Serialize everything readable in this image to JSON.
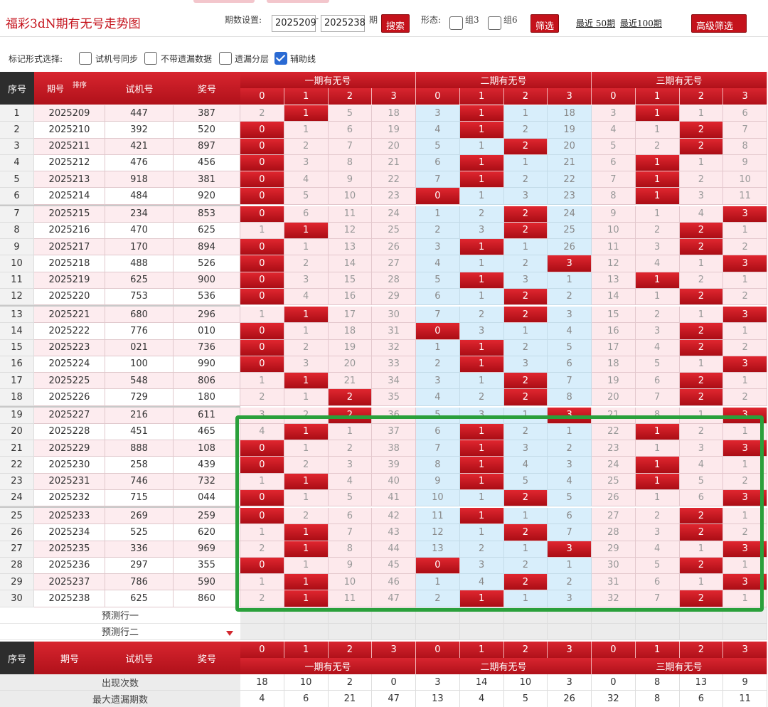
{
  "header": {
    "title": "福彩3dN期有无号走势图",
    "period_label": "期数设置:",
    "period_from": "2025209",
    "period_to": "2025238",
    "dash": "-",
    "period_suffix": "期",
    "search_label": "搜索",
    "shape_label": "形态:",
    "group3_label": "组3",
    "group6_label": "组6",
    "filter_label": "筛选",
    "recent50_label": "最近 50期",
    "recent100_label": "最近100期",
    "advanced_filter_label": "高级筛选"
  },
  "mark_options": {
    "label": "标记形式选择:",
    "items": [
      {
        "label": "试机号同步",
        "checked": false
      },
      {
        "label": "不带遗漏数据",
        "checked": false
      },
      {
        "label": "遗漏分层",
        "checked": false
      },
      {
        "label": "辅助线",
        "checked": true
      }
    ]
  },
  "table": {
    "col_index": "序号",
    "col_period": "期号",
    "sort_label": "排序",
    "col_trial": "试机号",
    "col_draw": "奖号",
    "group_titles": [
      "一期有无号",
      "二期有无号",
      "三期有无号"
    ],
    "sub_cols": [
      "0",
      "1",
      "2",
      "3"
    ],
    "rows": [
      {
        "i": "1",
        "p": "2025209",
        "t": "447",
        "d": "387",
        "v": [
          2,
          1,
          5,
          18,
          3,
          1,
          1,
          18,
          3,
          1,
          1,
          6
        ],
        "h": [
          0,
          1,
          0,
          0,
          0,
          1,
          0,
          0,
          0,
          1,
          0,
          0
        ]
      },
      {
        "i": "2",
        "p": "2025210",
        "t": "392",
        "d": "520",
        "v": [
          0,
          1,
          6,
          19,
          4,
          1,
          2,
          19,
          4,
          1,
          2,
          7
        ],
        "h": [
          1,
          0,
          0,
          0,
          0,
          1,
          0,
          0,
          0,
          0,
          1,
          0
        ]
      },
      {
        "i": "3",
        "p": "2025211",
        "t": "421",
        "d": "897",
        "v": [
          0,
          2,
          7,
          20,
          5,
          1,
          2,
          20,
          5,
          2,
          2,
          8
        ],
        "h": [
          1,
          0,
          0,
          0,
          0,
          0,
          1,
          0,
          0,
          0,
          1,
          0
        ]
      },
      {
        "i": "4",
        "p": "2025212",
        "t": "476",
        "d": "456",
        "v": [
          0,
          3,
          8,
          21,
          6,
          1,
          1,
          21,
          6,
          1,
          1,
          9
        ],
        "h": [
          1,
          0,
          0,
          0,
          0,
          1,
          0,
          0,
          0,
          1,
          0,
          0
        ]
      },
      {
        "i": "5",
        "p": "2025213",
        "t": "918",
        "d": "381",
        "v": [
          0,
          4,
          9,
          22,
          7,
          1,
          2,
          22,
          7,
          1,
          2,
          10
        ],
        "h": [
          1,
          0,
          0,
          0,
          0,
          1,
          0,
          0,
          0,
          1,
          0,
          0
        ]
      },
      {
        "i": "6",
        "p": "2025214",
        "t": "484",
        "d": "920",
        "v": [
          0,
          5,
          10,
          23,
          0,
          1,
          3,
          23,
          8,
          1,
          3,
          11
        ],
        "h": [
          1,
          0,
          0,
          0,
          1,
          0,
          0,
          0,
          0,
          1,
          0,
          0
        ]
      },
      {
        "i": "7",
        "p": "2025215",
        "t": "234",
        "d": "853",
        "v": [
          0,
          6,
          11,
          24,
          1,
          2,
          2,
          24,
          9,
          1,
          4,
          3
        ],
        "h": [
          1,
          0,
          0,
          0,
          0,
          0,
          1,
          0,
          0,
          0,
          0,
          1
        ]
      },
      {
        "i": "8",
        "p": "2025216",
        "t": "470",
        "d": "625",
        "v": [
          1,
          1,
          12,
          25,
          2,
          3,
          2,
          25,
          10,
          2,
          2,
          1
        ],
        "h": [
          0,
          1,
          0,
          0,
          0,
          0,
          1,
          0,
          0,
          0,
          1,
          0
        ]
      },
      {
        "i": "9",
        "p": "2025217",
        "t": "170",
        "d": "894",
        "v": [
          0,
          1,
          13,
          26,
          3,
          1,
          1,
          26,
          11,
          3,
          2,
          2
        ],
        "h": [
          1,
          0,
          0,
          0,
          0,
          1,
          0,
          0,
          0,
          0,
          1,
          0
        ]
      },
      {
        "i": "10",
        "p": "2025218",
        "t": "488",
        "d": "526",
        "v": [
          0,
          2,
          14,
          27,
          4,
          1,
          2,
          3,
          12,
          4,
          1,
          3
        ],
        "h": [
          1,
          0,
          0,
          0,
          0,
          0,
          0,
          1,
          0,
          0,
          0,
          1
        ]
      },
      {
        "i": "11",
        "p": "2025219",
        "t": "625",
        "d": "900",
        "v": [
          0,
          3,
          15,
          28,
          5,
          1,
          3,
          1,
          13,
          1,
          2,
          1
        ],
        "h": [
          1,
          0,
          0,
          0,
          0,
          1,
          0,
          0,
          0,
          1,
          0,
          0
        ]
      },
      {
        "i": "12",
        "p": "2025220",
        "t": "753",
        "d": "536",
        "v": [
          0,
          4,
          16,
          29,
          6,
          1,
          2,
          2,
          14,
          1,
          2,
          2
        ],
        "h": [
          1,
          0,
          0,
          0,
          0,
          0,
          1,
          0,
          0,
          0,
          1,
          0
        ]
      },
      {
        "i": "13",
        "p": "2025221",
        "t": "680",
        "d": "296",
        "v": [
          1,
          1,
          17,
          30,
          7,
          2,
          2,
          3,
          15,
          2,
          1,
          3
        ],
        "h": [
          0,
          1,
          0,
          0,
          0,
          0,
          1,
          0,
          0,
          0,
          0,
          1
        ]
      },
      {
        "i": "14",
        "p": "2025222",
        "t": "776",
        "d": "010",
        "v": [
          0,
          1,
          18,
          31,
          0,
          3,
          1,
          4,
          16,
          3,
          2,
          1
        ],
        "h": [
          1,
          0,
          0,
          0,
          1,
          0,
          0,
          0,
          0,
          0,
          1,
          0
        ]
      },
      {
        "i": "15",
        "p": "2025223",
        "t": "021",
        "d": "736",
        "v": [
          0,
          2,
          19,
          32,
          1,
          1,
          2,
          5,
          17,
          4,
          2,
          2
        ],
        "h": [
          1,
          0,
          0,
          0,
          0,
          1,
          0,
          0,
          0,
          0,
          1,
          0
        ]
      },
      {
        "i": "16",
        "p": "2025224",
        "t": "100",
        "d": "990",
        "v": [
          0,
          3,
          20,
          33,
          2,
          1,
          3,
          6,
          18,
          5,
          1,
          3
        ],
        "h": [
          1,
          0,
          0,
          0,
          0,
          1,
          0,
          0,
          0,
          0,
          0,
          1
        ]
      },
      {
        "i": "17",
        "p": "2025225",
        "t": "548",
        "d": "806",
        "v": [
          1,
          1,
          21,
          34,
          3,
          1,
          2,
          7,
          19,
          6,
          2,
          1
        ],
        "h": [
          0,
          1,
          0,
          0,
          0,
          0,
          1,
          0,
          0,
          0,
          1,
          0
        ]
      },
      {
        "i": "18",
        "p": "2025226",
        "t": "729",
        "d": "180",
        "v": [
          2,
          1,
          2,
          35,
          4,
          2,
          2,
          8,
          20,
          7,
          2,
          2
        ],
        "h": [
          0,
          0,
          1,
          0,
          0,
          0,
          1,
          0,
          0,
          0,
          1,
          0
        ]
      },
      {
        "i": "19",
        "p": "2025227",
        "t": "216",
        "d": "611",
        "v": [
          3,
          2,
          2,
          36,
          5,
          3,
          1,
          3,
          21,
          8,
          1,
          3
        ],
        "h": [
          0,
          0,
          1,
          0,
          0,
          0,
          0,
          1,
          0,
          0,
          0,
          1
        ]
      },
      {
        "i": "20",
        "p": "2025228",
        "t": "451",
        "d": "465",
        "v": [
          4,
          1,
          1,
          37,
          6,
          1,
          2,
          1,
          22,
          1,
          2,
          1
        ],
        "h": [
          0,
          1,
          0,
          0,
          0,
          1,
          0,
          0,
          0,
          1,
          0,
          0
        ]
      },
      {
        "i": "21",
        "p": "2025229",
        "t": "888",
        "d": "108",
        "v": [
          0,
          1,
          2,
          38,
          7,
          1,
          3,
          2,
          23,
          1,
          3,
          3
        ],
        "h": [
          1,
          0,
          0,
          0,
          0,
          1,
          0,
          0,
          0,
          0,
          0,
          1
        ]
      },
      {
        "i": "22",
        "p": "2025230",
        "t": "258",
        "d": "439",
        "v": [
          0,
          2,
          3,
          39,
          8,
          1,
          4,
          3,
          24,
          1,
          4,
          1
        ],
        "h": [
          1,
          0,
          0,
          0,
          0,
          1,
          0,
          0,
          0,
          1,
          0,
          0
        ]
      },
      {
        "i": "23",
        "p": "2025231",
        "t": "746",
        "d": "732",
        "v": [
          1,
          1,
          4,
          40,
          9,
          1,
          5,
          4,
          25,
          1,
          5,
          2
        ],
        "h": [
          0,
          1,
          0,
          0,
          0,
          1,
          0,
          0,
          0,
          1,
          0,
          0
        ]
      },
      {
        "i": "24",
        "p": "2025232",
        "t": "715",
        "d": "044",
        "v": [
          0,
          1,
          5,
          41,
          10,
          1,
          2,
          5,
          26,
          1,
          6,
          3
        ],
        "h": [
          1,
          0,
          0,
          0,
          0,
          0,
          1,
          0,
          0,
          0,
          0,
          1
        ]
      },
      {
        "i": "25",
        "p": "2025233",
        "t": "269",
        "d": "259",
        "v": [
          0,
          2,
          6,
          42,
          11,
          1,
          1,
          6,
          27,
          2,
          2,
          1
        ],
        "h": [
          1,
          0,
          0,
          0,
          0,
          1,
          0,
          0,
          0,
          0,
          1,
          0
        ]
      },
      {
        "i": "26",
        "p": "2025234",
        "t": "525",
        "d": "620",
        "v": [
          1,
          1,
          7,
          43,
          12,
          1,
          2,
          7,
          28,
          3,
          2,
          2
        ],
        "h": [
          0,
          1,
          0,
          0,
          0,
          0,
          1,
          0,
          0,
          0,
          1,
          0
        ]
      },
      {
        "i": "27",
        "p": "2025235",
        "t": "336",
        "d": "969",
        "v": [
          2,
          1,
          8,
          44,
          13,
          2,
          1,
          3,
          29,
          4,
          1,
          3
        ],
        "h": [
          0,
          1,
          0,
          0,
          0,
          0,
          0,
          1,
          0,
          0,
          0,
          1
        ]
      },
      {
        "i": "28",
        "p": "2025236",
        "t": "297",
        "d": "355",
        "v": [
          0,
          1,
          9,
          45,
          0,
          3,
          2,
          1,
          30,
          5,
          2,
          1
        ],
        "h": [
          1,
          0,
          0,
          0,
          1,
          0,
          0,
          0,
          0,
          0,
          1,
          0
        ]
      },
      {
        "i": "29",
        "p": "2025237",
        "t": "786",
        "d": "590",
        "v": [
          1,
          1,
          10,
          46,
          1,
          4,
          2,
          2,
          31,
          6,
          1,
          3
        ],
        "h": [
          0,
          1,
          0,
          0,
          0,
          0,
          1,
          0,
          0,
          0,
          0,
          1
        ]
      },
      {
        "i": "30",
        "p": "2025238",
        "t": "625",
        "d": "860",
        "v": [
          2,
          1,
          11,
          47,
          2,
          1,
          1,
          3,
          32,
          7,
          2,
          1
        ],
        "h": [
          0,
          1,
          0,
          0,
          0,
          1,
          0,
          0,
          0,
          0,
          1,
          0
        ]
      }
    ],
    "predict_rows": [
      "预测行一",
      "预测行二"
    ],
    "stats": [
      {
        "label": "出现次数",
        "values": [
          18,
          10,
          2,
          0,
          3,
          14,
          10,
          3,
          0,
          8,
          13,
          9
        ]
      },
      {
        "label": "最大遗漏期数",
        "values": [
          4,
          6,
          21,
          47,
          13,
          4,
          5,
          26,
          32,
          8,
          6,
          11
        ]
      }
    ]
  },
  "colors": {
    "brand_red": "#c4121b",
    "hit_red": "#d2282f",
    "group1_bg": "#fde9ec",
    "group2_bg": "#d8eefb",
    "highlight_green": "#2aa03b",
    "checkbox_blue": "#2a6ad3"
  }
}
